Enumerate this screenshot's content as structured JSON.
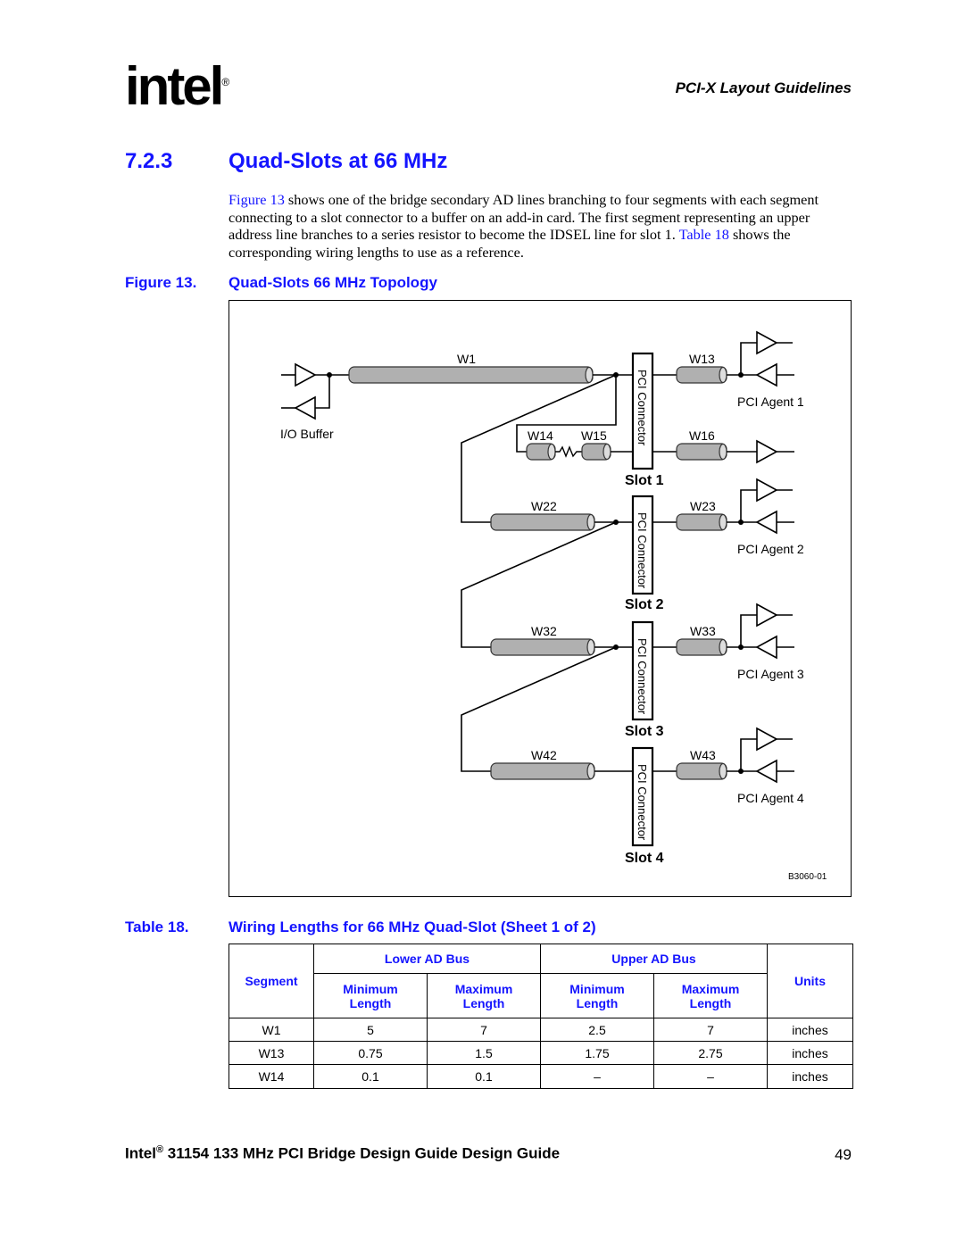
{
  "header": {
    "logo": "intel",
    "running_title": "PCI-X Layout Guidelines"
  },
  "section": {
    "number": "7.2.3",
    "title": "Quad-Slots at 66 MHz"
  },
  "paragraph": {
    "link1": "Figure 13",
    "text1": " shows one of the bridge secondary AD lines branching to four segments with each segment connecting to a slot connector to a buffer on an add-in card. The first segment representing an upper address line branches to a series resistor to become the IDSEL line for slot 1. ",
    "link2": "Table 18",
    "text2": " shows the corresponding wiring lengths to use as a reference."
  },
  "figure": {
    "label": "Figure 13.",
    "title": "Quad-Slots 66 MHz Topology",
    "labels": {
      "io_buffer": "I/O Buffer",
      "w1": "W1",
      "w14": "W14",
      "w15": "W15",
      "w13": "W13",
      "w16": "W16",
      "w22": "W22",
      "w23": "W23",
      "w32": "W32",
      "w33": "W33",
      "w42": "W42",
      "w43": "W43",
      "connector": "PCI Connector",
      "slot1": "Slot 1",
      "slot2": "Slot 2",
      "slot3": "Slot 3",
      "slot4": "Slot 4",
      "agent1": "PCI Agent 1",
      "agent2": "PCI Agent 2",
      "agent3": "PCI Agent 3",
      "agent4": "PCI Agent 4",
      "code": "B3060-01"
    }
  },
  "table": {
    "label": "Table 18.",
    "title": "Wiring Lengths for 66 MHz Quad-Slot (Sheet 1 of 2)",
    "headers": {
      "segment": "Segment",
      "lower": "Lower AD Bus",
      "upper": "Upper AD Bus",
      "units": "Units",
      "min": "Minimum Length",
      "max": "Maximum Length"
    },
    "rows": [
      [
        "W1",
        "5",
        "7",
        "2.5",
        "7",
        "inches"
      ],
      [
        "W13",
        "0.75",
        "1.5",
        "1.75",
        "2.75",
        "inches"
      ],
      [
        "W14",
        "0.1",
        "0.1",
        "–",
        "–",
        "inches"
      ]
    ]
  },
  "footer": {
    "brand": "Intel",
    "reg": "®",
    "title": " 31154 133 MHz PCI Bridge Design Guide Design Guide",
    "page": "49"
  }
}
